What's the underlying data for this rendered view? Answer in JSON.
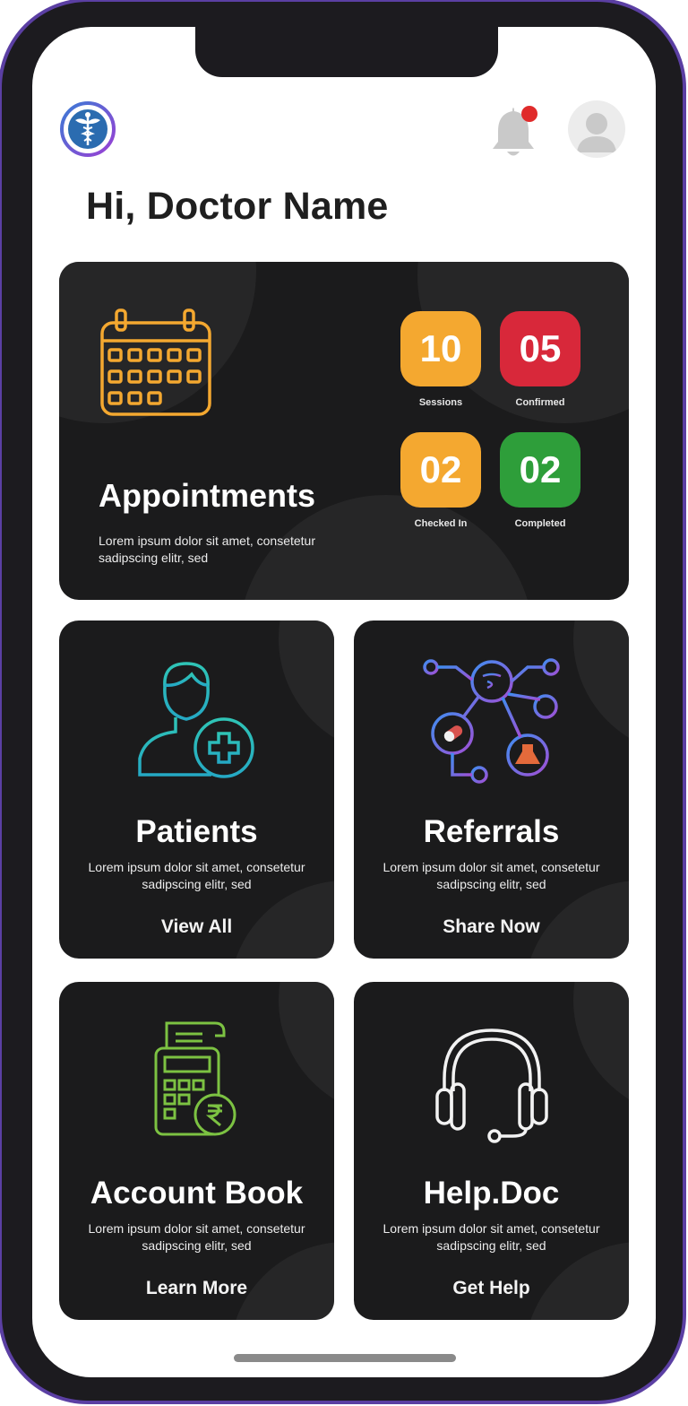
{
  "header": {
    "greeting": "Hi, Doctor Name",
    "logo_icon": "caduceus-icon",
    "notification_icon": "bell-icon",
    "notification_dot_color": "#e02b2b",
    "avatar_icon": "user-icon"
  },
  "appointments": {
    "title": "Appointments",
    "description": "Lorem ipsum dolor sit amet, consetetur sadipscing elitr, sed",
    "icon": "calendar-icon",
    "stats": [
      {
        "value": "10",
        "label": "Sessions",
        "color": "#f4a830"
      },
      {
        "value": "05",
        "label": "Confirmed",
        "color": "#d8283a"
      },
      {
        "value": "02",
        "label": "Checked In",
        "color": "#f4a830"
      },
      {
        "value": "02",
        "label": "Completed",
        "color": "#2e9e3a"
      }
    ]
  },
  "tiles": {
    "patients": {
      "title": "Patients",
      "description": "Lorem ipsum dolor sit amet, consetetur sadipscing elitr, sed",
      "action": "View All",
      "icon": "add-patient-icon"
    },
    "referrals": {
      "title": "Referrals",
      "description": "Lorem ipsum dolor sit amet, consetetur sadipscing elitr, sed",
      "action": "Share Now",
      "icon": "referral-network-icon"
    },
    "account_book": {
      "title": "Account Book",
      "description": "Lorem ipsum dolor sit amet, consetetur sadipscing elitr, sed",
      "action": "Learn More",
      "icon": "billing-machine-icon"
    },
    "help_doc": {
      "title": "Help.Doc",
      "description": "Lorem ipsum dolor sit amet, consetetur sadipscing elitr, sed",
      "action": "Get Help",
      "icon": "headset-icon"
    }
  },
  "colors": {
    "frame": "#1c1b1f",
    "frame_accent": "#5b3fa3",
    "card_bg": "#1b1b1c",
    "calendar_orange": "#f4a830",
    "patients_teal": "#2fc4b6",
    "referrals_blue": "#4d7fe6",
    "referrals_purple": "#a14fd4",
    "account_green": "#7cc242"
  }
}
